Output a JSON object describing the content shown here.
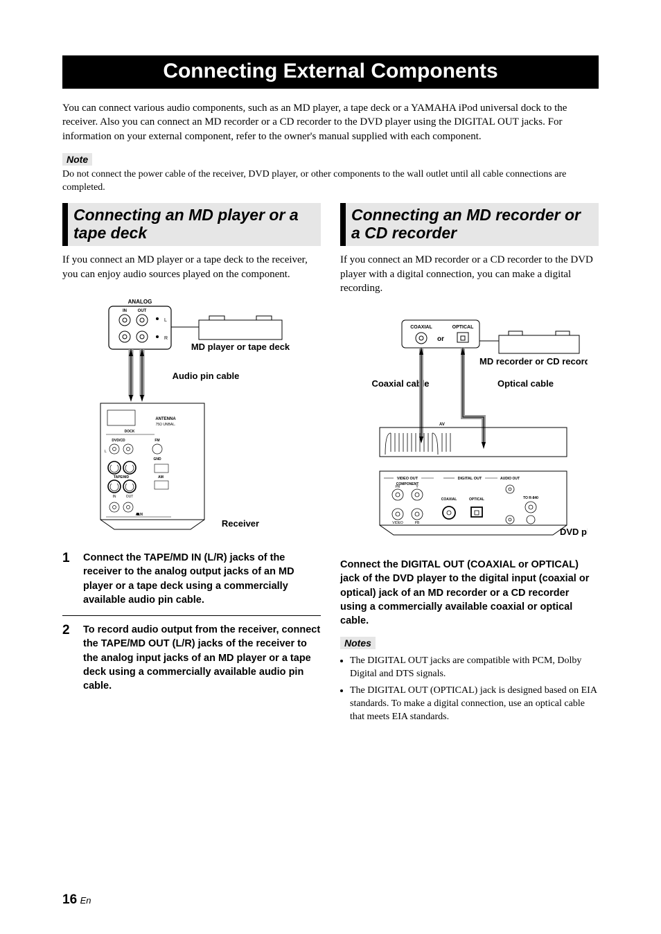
{
  "banner": "Connecting External Components",
  "intro": "You can connect various audio components, such as an MD player, a tape deck or a YAMAHA iPod universal dock to the receiver. Also you can connect an MD recorder or a CD recorder to the DVD player using the DIGITAL OUT jacks. For information on your external component, refer to the owner's manual supplied with each component.",
  "note_label": "Note",
  "note_text": "Do not connect the power cable of the receiver, DVD player, or other components to the wall outlet until all cable connections are completed.",
  "left": {
    "header": "Connecting an MD player or a tape deck",
    "intro": "If you connect an MD player or a tape deck to the receiver, you can enjoy audio sources played on the component.",
    "dia": {
      "analog": "ANALOG",
      "in": "IN",
      "out": "OUT",
      "device": "MD player or tape deck",
      "cable": "Audio pin cable",
      "antenna": "ANTENNA",
      "unbal": "75Ω UNBAL.",
      "dock": "DOCK",
      "dvdcd": "DVD/CD",
      "fm": "FM",
      "gnd": "GND",
      "tapemd": "TAPE/MD",
      "am": "AM",
      "aux": "AUX",
      "receiver": "Receiver",
      "l": "L",
      "r": "R",
      "in2": "IN",
      "out2": "OUT"
    },
    "steps": [
      {
        "n": "1",
        "t": "Connect the TAPE/MD IN (L/R) jacks of the receiver to the analog output jacks of an MD player or a tape deck using a commercially available audio pin cable."
      },
      {
        "n": "2",
        "t": "To record audio output from the receiver, connect the TAPE/MD OUT (L/R) jacks of the receiver to the analog input jacks of an MD player or a tape deck using a commercially available audio pin cable."
      }
    ]
  },
  "right": {
    "header": "Connecting an MD recorder or a CD recorder",
    "intro": "If you connect an MD recorder or a CD recorder to the DVD player with a digital connection, you can make a digital recording.",
    "dia": {
      "coax_lbl": "COAXIAL",
      "opt_lbl": "OPTICAL",
      "or": "or",
      "device": "MD recorder or CD recorder",
      "coax_cable": "Coaxial cable",
      "opt_cable": "Optical cable",
      "av": "AV",
      "video_out": "VIDEO OUT",
      "component": "COMPONENT",
      "digital_out": "DIGITAL OUT",
      "audio_out": "AUDIO OUT",
      "coaxial": "COAXIAL",
      "optical": "OPTICAL",
      "mix2ch": "TO R-840",
      "video": "VIDEO",
      "pb": "PB",
      "pr": "PR",
      "y": "Y",
      "dvd": "DVD player"
    },
    "connect": "Connect the DIGITAL OUT (COAXIAL or OPTICAL) jack of the DVD player to the digital input (coaxial or optical) jack of an MD recorder or a CD recorder using a commercially available coaxial or optical cable.",
    "notes_label": "Notes",
    "notes": [
      "The DIGITAL OUT jacks are compatible with PCM, Dolby Digital and DTS signals.",
      "The DIGITAL OUT (OPTICAL) jack is designed based on EIA standards. To make a digital connection, use an optical cable that meets EIA standards."
    ]
  },
  "page": {
    "num": "16",
    "suffix": "En"
  }
}
